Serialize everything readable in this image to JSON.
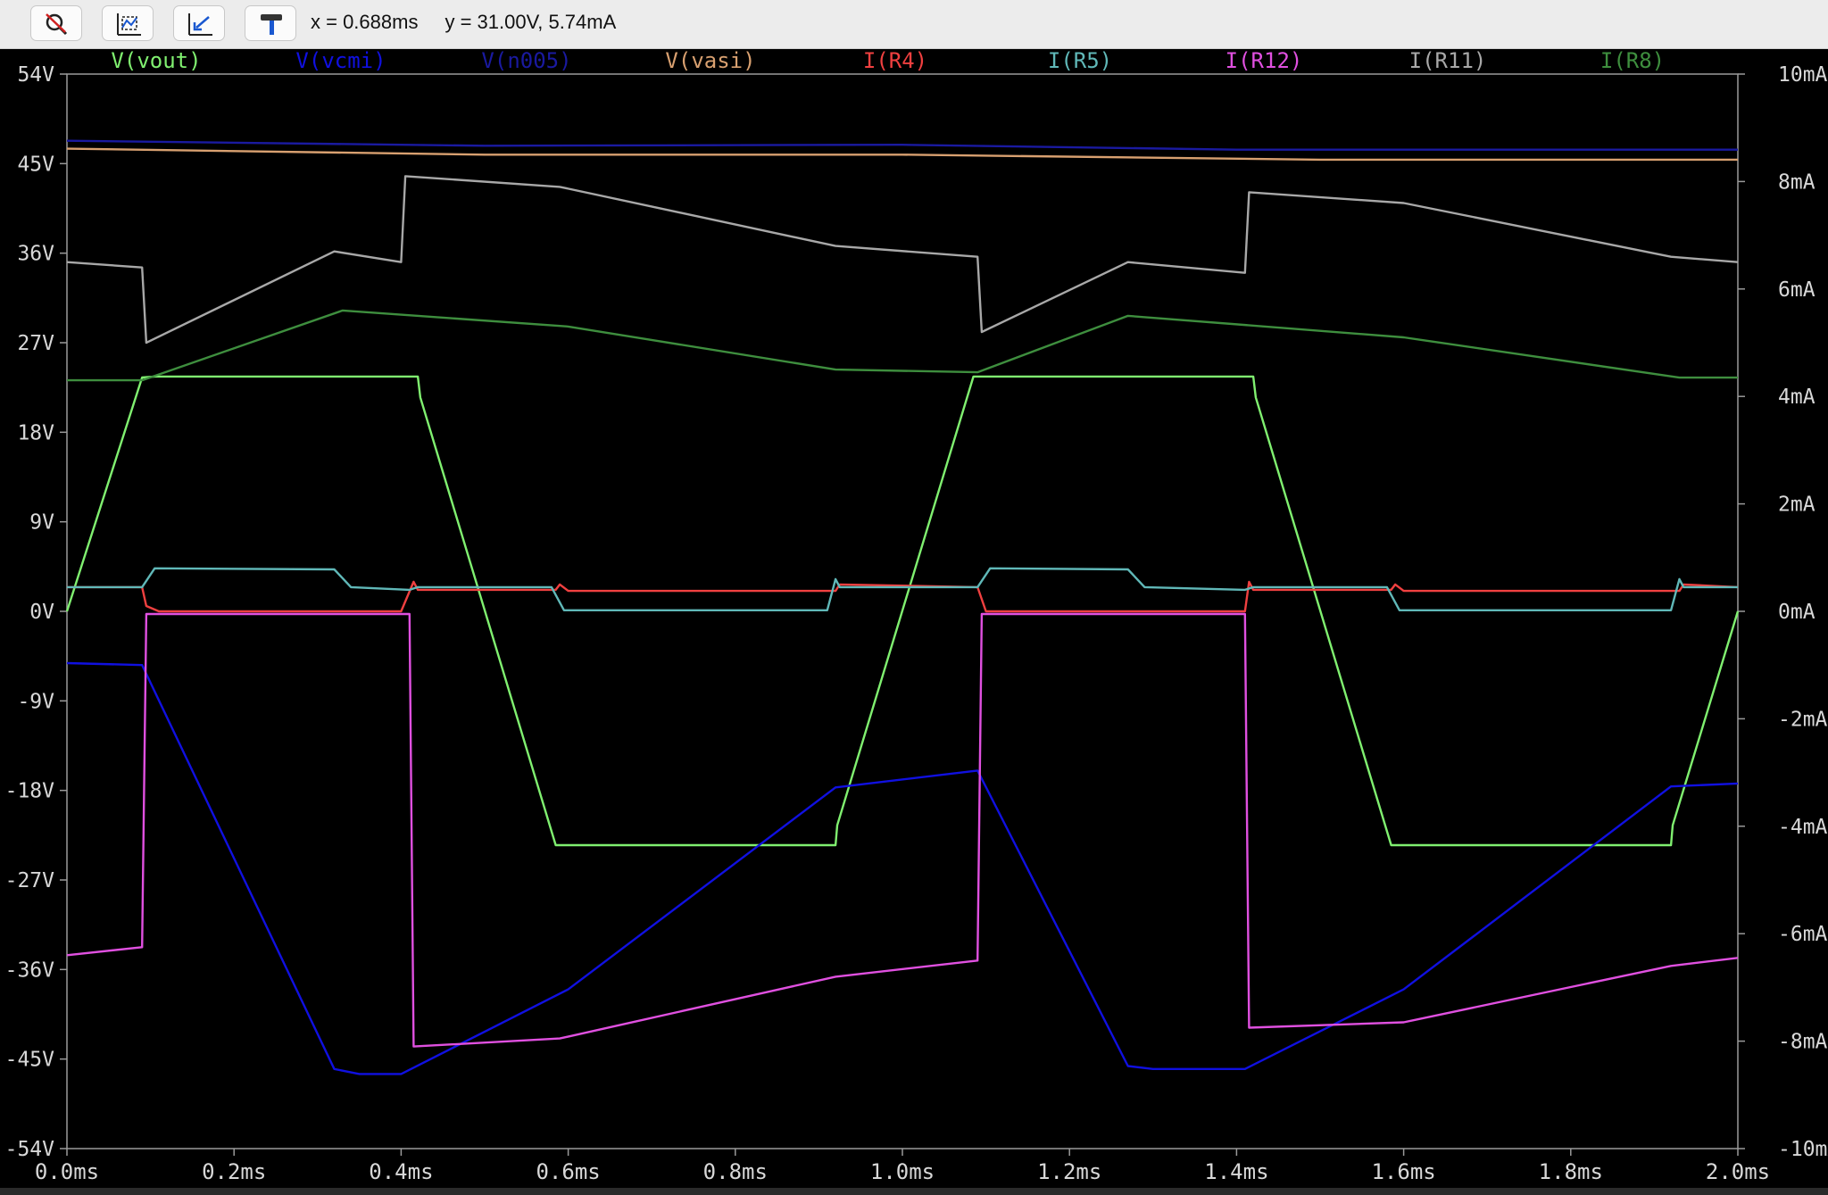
{
  "toolbar": {
    "buttons": [
      {
        "name": "zoom-cancel",
        "icon": "zoom-cancel-icon"
      },
      {
        "name": "autorange",
        "icon": "autorange-icon"
      },
      {
        "name": "zoom-back",
        "icon": "zoom-back-icon"
      },
      {
        "name": "probe",
        "icon": "hammer-icon"
      }
    ],
    "cursor_x": "x = 0.688ms",
    "cursor_y": "y = 31.00V, 5.74mA"
  },
  "chart_data": {
    "type": "line",
    "background": "#000000",
    "x": {
      "unit": "ms",
      "lim": [
        0,
        2
      ],
      "ticks": [
        0,
        0.2,
        0.4,
        0.6,
        0.8,
        1.0,
        1.2,
        1.4,
        1.6,
        1.8,
        2.0
      ],
      "tick_labels": [
        "0.0ms",
        "0.2ms",
        "0.4ms",
        "0.6ms",
        "0.8ms",
        "1.0ms",
        "1.2ms",
        "1.4ms",
        "1.6ms",
        "1.8ms",
        "2.0ms"
      ]
    },
    "y_left": {
      "unit": "V",
      "lim": [
        -54,
        54
      ],
      "ticks": [
        54,
        45,
        36,
        27,
        18,
        9,
        0,
        -9,
        -18,
        -27,
        -36,
        -45,
        -54
      ],
      "tick_labels": [
        "54V",
        "45V",
        "36V",
        "27V",
        "18V",
        "9V",
        "0V",
        "-9V",
        "-18V",
        "-27V",
        "-36V",
        "-45V",
        "-54V"
      ]
    },
    "y_right": {
      "unit": "mA",
      "lim": [
        -10,
        10
      ],
      "ticks": [
        10,
        8,
        6,
        4,
        2,
        0,
        -2,
        -4,
        -6,
        -8,
        -10
      ],
      "tick_labels": [
        "10mA",
        "8mA",
        "6mA",
        "4mA",
        "2mA",
        "0mA",
        "-2mA",
        "-4mA",
        "-6mA",
        "-8mA",
        "-10mA"
      ]
    },
    "grid": false,
    "legend": "top",
    "series": [
      {
        "name": "V(vout)",
        "axis": "left",
        "color": "#80f070",
        "points": [
          [
            0,
            0
          ],
          [
            0.09,
            23.5
          ],
          [
            0.105,
            23.6
          ],
          [
            0.42,
            23.6
          ],
          [
            0.423,
            21.5
          ],
          [
            0.585,
            -23.5
          ],
          [
            0.92,
            -23.5
          ],
          [
            0.922,
            -21.5
          ],
          [
            1.085,
            23.6
          ],
          [
            1.42,
            23.6
          ],
          [
            1.423,
            21.5
          ],
          [
            1.585,
            -23.5
          ],
          [
            1.92,
            -23.5
          ],
          [
            1.922,
            -21.5
          ],
          [
            2.0,
            0
          ]
        ]
      },
      {
        "name": "V(vcmi)",
        "axis": "left",
        "color": "#1010e0",
        "points": [
          [
            0,
            -5.2
          ],
          [
            0.09,
            -5.4
          ],
          [
            0.32,
            -46
          ],
          [
            0.35,
            -46.5
          ],
          [
            0.4,
            -46.5
          ],
          [
            0.6,
            -38
          ],
          [
            0.92,
            -17.7
          ],
          [
            1.09,
            -16
          ],
          [
            1.27,
            -45.7
          ],
          [
            1.3,
            -46
          ],
          [
            1.41,
            -46
          ],
          [
            1.6,
            -38
          ],
          [
            1.92,
            -17.6
          ],
          [
            2.0,
            -17.3
          ]
        ]
      },
      {
        "name": "V(n005)",
        "axis": "left",
        "color": "#1a1aa0",
        "points": [
          [
            0,
            47.3
          ],
          [
            0.5,
            46.8
          ],
          [
            1.0,
            46.9
          ],
          [
            1.4,
            46.4
          ],
          [
            2.0,
            46.4
          ]
        ]
      },
      {
        "name": "V(vasi)",
        "axis": "left",
        "color": "#d8a070",
        "points": [
          [
            0,
            46.5
          ],
          [
            0.5,
            45.9
          ],
          [
            1.0,
            45.9
          ],
          [
            1.5,
            45.4
          ],
          [
            2.0,
            45.4
          ]
        ]
      },
      {
        "name": "I(R4)",
        "axis": "right",
        "color": "#f04040",
        "points": [
          [
            0,
            0.45
          ],
          [
            0.09,
            0.45
          ],
          [
            0.095,
            0.1
          ],
          [
            0.11,
            0
          ],
          [
            0.4,
            0
          ],
          [
            0.415,
            0.55
          ],
          [
            0.42,
            0.4
          ],
          [
            0.585,
            0.4
          ],
          [
            0.59,
            0.5
          ],
          [
            0.6,
            0.38
          ],
          [
            0.92,
            0.38
          ],
          [
            0.925,
            0.5
          ],
          [
            1.09,
            0.45
          ],
          [
            1.1,
            0
          ],
          [
            1.41,
            0
          ],
          [
            1.415,
            0.55
          ],
          [
            1.42,
            0.4
          ],
          [
            1.585,
            0.4
          ],
          [
            1.59,
            0.5
          ],
          [
            1.6,
            0.38
          ],
          [
            1.93,
            0.38
          ],
          [
            1.935,
            0.5
          ],
          [
            2.0,
            0.45
          ]
        ]
      },
      {
        "name": "I(R5)",
        "axis": "right",
        "color": "#60b8b8",
        "points": [
          [
            0,
            0.45
          ],
          [
            0.09,
            0.45
          ],
          [
            0.105,
            0.8
          ],
          [
            0.32,
            0.78
          ],
          [
            0.34,
            0.45
          ],
          [
            0.41,
            0.4
          ],
          [
            0.42,
            0.45
          ],
          [
            0.58,
            0.45
          ],
          [
            0.595,
            0.02
          ],
          [
            0.91,
            0.02
          ],
          [
            0.92,
            0.6
          ],
          [
            0.925,
            0.45
          ],
          [
            1.09,
            0.45
          ],
          [
            1.105,
            0.8
          ],
          [
            1.27,
            0.78
          ],
          [
            1.29,
            0.45
          ],
          [
            1.41,
            0.4
          ],
          [
            1.42,
            0.45
          ],
          [
            1.58,
            0.45
          ],
          [
            1.595,
            0.02
          ],
          [
            1.92,
            0.02
          ],
          [
            1.93,
            0.6
          ],
          [
            1.935,
            0.45
          ],
          [
            2.0,
            0.45
          ]
        ]
      },
      {
        "name": "I(R12)",
        "axis": "right",
        "color": "#e050e0",
        "points": [
          [
            0,
            -6.4
          ],
          [
            0.09,
            -6.25
          ],
          [
            0.095,
            -0.05
          ],
          [
            0.41,
            -0.05
          ],
          [
            0.415,
            -8.1
          ],
          [
            0.59,
            -7.95
          ],
          [
            0.92,
            -6.8
          ],
          [
            1.09,
            -6.5
          ],
          [
            1.095,
            -0.05
          ],
          [
            1.41,
            -0.05
          ],
          [
            1.415,
            -7.75
          ],
          [
            1.6,
            -7.65
          ],
          [
            1.92,
            -6.6
          ],
          [
            2.0,
            -6.45
          ]
        ]
      },
      {
        "name": "I(R11)",
        "axis": "right",
        "color": "#a8a8a8",
        "points": [
          [
            0,
            6.5
          ],
          [
            0.09,
            6.4
          ],
          [
            0.095,
            5.0
          ],
          [
            0.32,
            6.7
          ],
          [
            0.4,
            6.5
          ],
          [
            0.405,
            8.1
          ],
          [
            0.59,
            7.9
          ],
          [
            0.92,
            6.8
          ],
          [
            1.09,
            6.6
          ],
          [
            1.095,
            5.2
          ],
          [
            1.27,
            6.5
          ],
          [
            1.41,
            6.3
          ],
          [
            1.415,
            7.8
          ],
          [
            1.6,
            7.6
          ],
          [
            1.92,
            6.6
          ],
          [
            2.0,
            6.5
          ]
        ]
      },
      {
        "name": "I(R8)",
        "axis": "right",
        "color": "#3e8e3e",
        "points": [
          [
            0,
            4.3
          ],
          [
            0.09,
            4.3
          ],
          [
            0.33,
            5.6
          ],
          [
            0.6,
            5.3
          ],
          [
            0.92,
            4.5
          ],
          [
            1.09,
            4.45
          ],
          [
            1.27,
            5.5
          ],
          [
            1.6,
            5.1
          ],
          [
            1.93,
            4.35
          ],
          [
            2.0,
            4.35
          ]
        ]
      }
    ]
  }
}
